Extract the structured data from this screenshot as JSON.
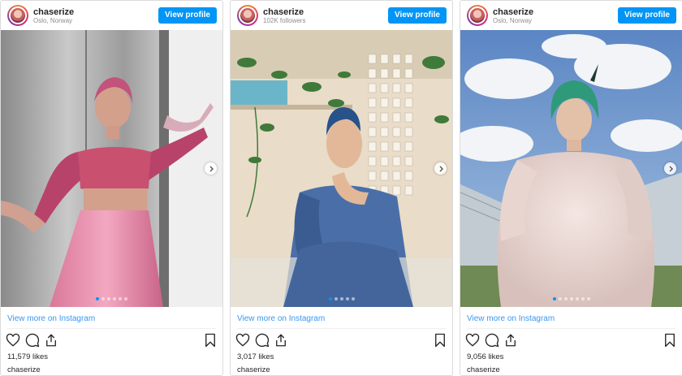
{
  "posts": [
    {
      "username": "chaserize",
      "subtitle": "Oslo, Norway",
      "view_profile": "View profile",
      "view_more": "View more on Instagram",
      "likes": "11,579 likes",
      "caption_user": "chaserize",
      "dots_total": 6,
      "dot_active": 1
    },
    {
      "username": "chaserize",
      "subtitle": "102K followers",
      "view_profile": "View profile",
      "view_more": "View more on Instagram",
      "likes": "3,017 likes",
      "caption_user": "chaserize",
      "dots_total": 5,
      "dot_active": 1
    },
    {
      "username": "chaserize",
      "subtitle": "Oslo, Norway",
      "view_profile": "View profile",
      "view_more": "View more on Instagram",
      "likes": "9,056 likes",
      "caption_user": "chaserize",
      "dots_total": 7,
      "dot_active": 1
    }
  ],
  "icons": {
    "like": "heart-icon",
    "comment": "comment-icon",
    "share": "share-icon",
    "save": "bookmark-icon",
    "next": "chevron-right-icon"
  },
  "colors": {
    "accent": "#0095f6",
    "link": "#3897f0"
  }
}
